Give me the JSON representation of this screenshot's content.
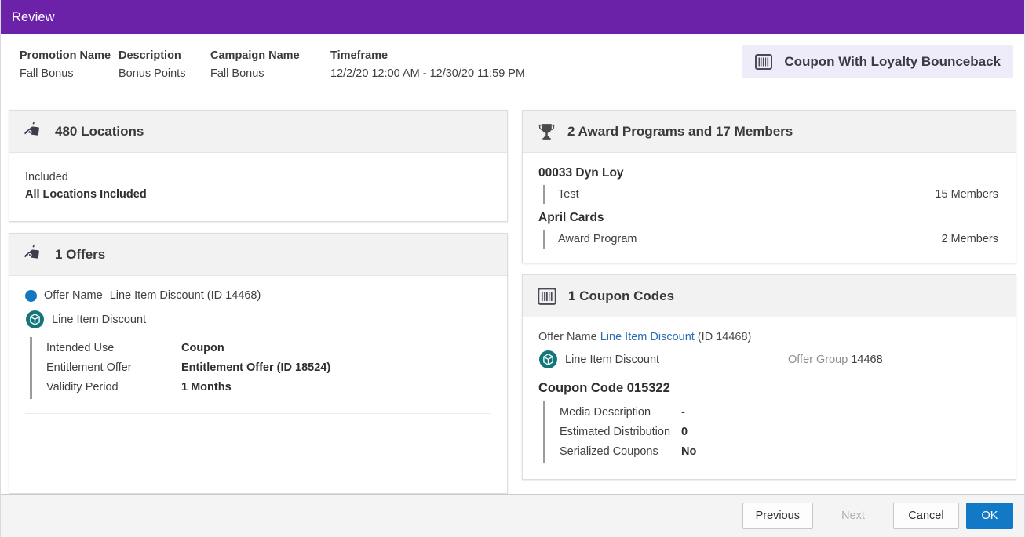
{
  "window": {
    "title": "Review"
  },
  "summary": {
    "fields": [
      {
        "label": "Promotion Name",
        "value": "Fall Bonus"
      },
      {
        "label": "Description",
        "value": "Bonus Points"
      },
      {
        "label": "Campaign Name",
        "value": "Fall Bonus"
      },
      {
        "label": "Timeframe",
        "value": "12/2/20 12:00 AM - 12/30/20 11:59 PM"
      }
    ],
    "type_badge": {
      "icon": "barcode-icon",
      "label": "Coupon With Loyalty Bounceback",
      "background": "#eeecf8"
    }
  },
  "locations_card": {
    "icon": "price-tag-icon",
    "title": "480 Locations",
    "included_label": "Included",
    "included_value": "All Locations Included"
  },
  "offers_card": {
    "icon": "price-tag-icon",
    "title": "1 Offers",
    "bullet_color": "#1277c0",
    "offer_name_label": "Offer Name",
    "offer_name_value": "Line Item Discount (ID 14468)",
    "offer_type_icon": "cube-icon",
    "offer_type_label": "Line Item Discount",
    "details": [
      {
        "key": "Intended Use",
        "value": "Coupon"
      },
      {
        "key": "Entitlement Offer",
        "value": "Entitlement Offer (ID 18524)"
      },
      {
        "key": "Validity Period",
        "value": "1 Months"
      }
    ]
  },
  "award_card": {
    "icon": "trophy-icon",
    "title": "2 Award Programs and 17 Members",
    "groups": [
      {
        "name": "00033 Dyn Loy",
        "items": [
          {
            "name": "Test",
            "count": "15 Members"
          }
        ]
      },
      {
        "name": "April Cards",
        "items": [
          {
            "name": "Award Program",
            "count": "2 Members"
          }
        ]
      }
    ]
  },
  "coupon_card": {
    "icon": "barcode-icon",
    "title": "1 Coupon Codes",
    "offer_name_label": "Offer Name",
    "offer_name_link": "Line Item Discount",
    "offer_name_id": "(ID 14468)",
    "offer_type_icon": "cube-icon",
    "offer_type_label": "Line Item Discount",
    "offer_group_label": "Offer Group",
    "offer_group_value": "14468",
    "coupon_code_title": "Coupon Code 015322",
    "details": [
      {
        "key": "Media Description",
        "value": "-"
      },
      {
        "key": "Estimated Distribution",
        "value": "0"
      },
      {
        "key": "Serialized Coupons",
        "value": "No"
      }
    ]
  },
  "footer": {
    "previous_label": "Previous",
    "next_label": "Next",
    "cancel_label": "Cancel",
    "ok_label": "OK",
    "primary_color": "#1279c6"
  }
}
